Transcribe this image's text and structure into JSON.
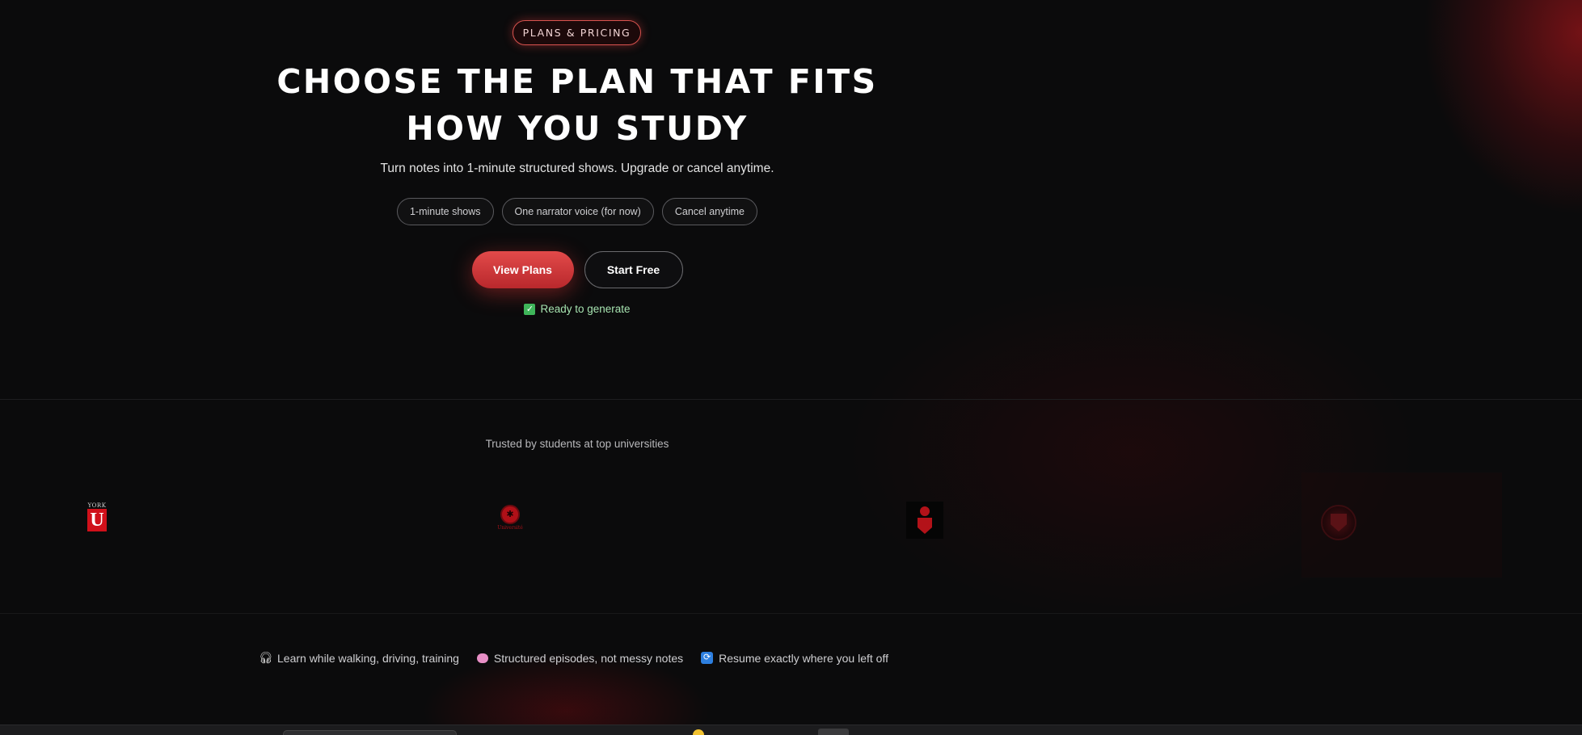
{
  "hero": {
    "eyebrow": "PLANS & PRICING",
    "headline": "CHOOSE THE PLAN THAT FITS HOW YOU STUDY",
    "subhead": "Turn notes into 1-minute structured shows. Upgrade or cancel anytime.",
    "pills": [
      "1-minute shows",
      "One narrator voice (for now)",
      "Cancel anytime"
    ],
    "primary_cta": "View Plans",
    "secondary_cta": "Start Free",
    "status": "Ready to generate"
  },
  "trust": {
    "label": "Trusted by students at top universities",
    "logos": [
      {
        "name": "York University",
        "text_top": "YORK",
        "mark": "U"
      },
      {
        "name": "University seal",
        "caption": "Université"
      },
      {
        "name": "University crest"
      },
      {
        "name": "University crest faded"
      }
    ]
  },
  "features": [
    {
      "icon": "headphones-icon",
      "label": "Learn while walking, driving, training"
    },
    {
      "icon": "brain-icon",
      "label": "Structured episodes, not messy notes"
    },
    {
      "icon": "repeat-icon",
      "label": "Resume exactly where you left off"
    }
  ],
  "colors": {
    "accent": "#d9534f",
    "primary_button": "#e24a4a",
    "status_text": "#a6e3b0",
    "background": "#0b0b0c"
  }
}
